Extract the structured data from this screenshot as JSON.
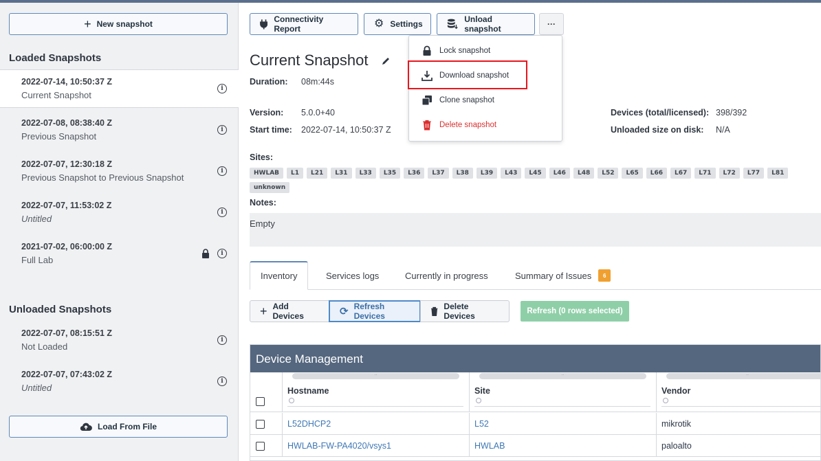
{
  "sidebar": {
    "new_snapshot": "New snapshot",
    "loaded_title": "Loaded Snapshots",
    "loaded": [
      {
        "date": "2022-07-14, 10:50:37 Z",
        "name": "Current Snapshot"
      },
      {
        "date": "2022-07-08, 08:38:40 Z",
        "name": "Previous Snapshot"
      },
      {
        "date": "2022-07-07, 12:30:18 Z",
        "name": "Previous Snapshot to Previous Snapshot"
      },
      {
        "date": "2022-07-07, 11:53:02 Z",
        "name": "Untitled"
      },
      {
        "date": "2021-07-02, 06:00:00 Z",
        "name": "Full Lab"
      }
    ],
    "unloaded_title": "Unloaded Snapshots",
    "unloaded": [
      {
        "date": "2022-07-07, 08:15:51 Z",
        "name": "Not Loaded"
      },
      {
        "date": "2022-07-07, 07:43:02 Z",
        "name": "Untitled"
      }
    ],
    "load_from_file": "Load From File"
  },
  "toolbar": {
    "connectivity_report": "Connectivity Report",
    "settings": "Settings",
    "unload_snapshot": "Unload snapshot",
    "more": "···"
  },
  "menu": {
    "lock": "Lock snapshot",
    "download": "Download snapshot",
    "clone": "Clone snapshot",
    "delete": "Delete snapshot"
  },
  "snapshot": {
    "title": "Current Snapshot",
    "duration_label": "Duration:",
    "duration": "08m:44s",
    "version_label": "Version:",
    "version": "5.0.0+40",
    "start_label": "Start time:",
    "start": "2022-07-14, 10:50:37 Z",
    "devices_label": "Devices (total/licensed):",
    "devices": "398/392",
    "unloaded_size_label": "Unloaded size on disk:",
    "unloaded_size": "N/A",
    "sites_label": "Sites:",
    "sites": [
      "HWLAB",
      "L1",
      "L21",
      "L31",
      "L33",
      "L35",
      "L36",
      "L37",
      "L38",
      "L39",
      "L43",
      "L45",
      "L46",
      "L48",
      "L52",
      "L65",
      "L66",
      "L67",
      "L71",
      "L72",
      "L77",
      "L81",
      "unknown"
    ],
    "notes_label": "Notes:",
    "notes": "Empty"
  },
  "tabs": [
    {
      "label": "Inventory"
    },
    {
      "label": "Services logs"
    },
    {
      "label": "Currently in progress"
    },
    {
      "label": "Summary of Issues",
      "badge": "6"
    }
  ],
  "actions": {
    "add": "Add Devices",
    "refresh": "Refresh Devices",
    "delete": "Delete Devices",
    "refresh_rows": "Refresh (0 rows selected)"
  },
  "grid": {
    "title": "Device Management",
    "columns": [
      "Hostname",
      "Site",
      "Vendor"
    ],
    "rows": [
      {
        "hostname": "L52DHCP2",
        "site": "L52",
        "vendor": "mikrotik"
      },
      {
        "hostname": "HWLAB-FW-PA4020/vsys1",
        "site": "HWLAB",
        "vendor": "paloalto"
      }
    ]
  },
  "colors": {
    "accent": "#5f87b8",
    "danger": "#d93030",
    "highlight": "#e8161d",
    "grid_header": "#55677f",
    "badge": "#f0a030",
    "refresh_green": "#8fcfa8"
  }
}
